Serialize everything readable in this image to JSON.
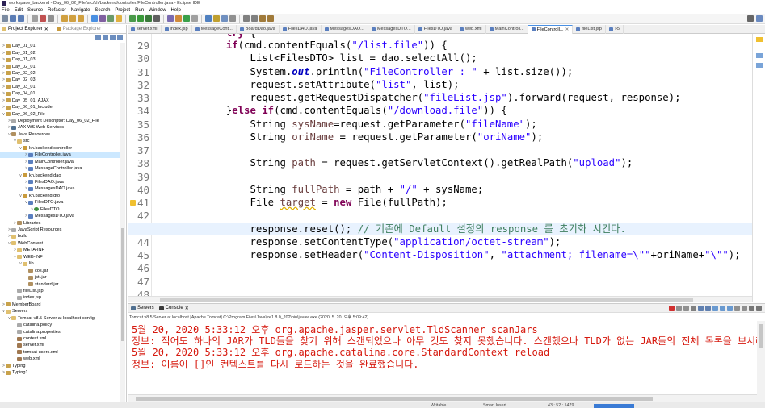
{
  "window": {
    "title": "workspace_backend - Day_06_02_File/src/kh/backend/controller/FileController.java - Eclipse IDE"
  },
  "menu": [
    "File",
    "Edit",
    "Source",
    "Refactor",
    "Navigate",
    "Search",
    "Project",
    "Run",
    "Window",
    "Help"
  ],
  "left_panel": {
    "tabs": [
      {
        "label": "Project Explorer",
        "close": "✕"
      },
      {
        "label": "Package Explorer"
      }
    ],
    "tree": [
      {
        "indent": 0,
        "arrow": ">",
        "icon": "proj",
        "label": "Day_01_01"
      },
      {
        "indent": 0,
        "arrow": ">",
        "icon": "proj",
        "label": "Day_01_02"
      },
      {
        "indent": 0,
        "arrow": ">",
        "icon": "proj",
        "label": "Day_01_03"
      },
      {
        "indent": 0,
        "arrow": ">",
        "icon": "proj",
        "label": "Day_02_01"
      },
      {
        "indent": 0,
        "arrow": ">",
        "icon": "proj",
        "label": "Day_02_02"
      },
      {
        "indent": 0,
        "arrow": ">",
        "icon": "proj",
        "label": "Day_02_03"
      },
      {
        "indent": 0,
        "arrow": ">",
        "icon": "proj",
        "label": "Day_03_01"
      },
      {
        "indent": 0,
        "arrow": ">",
        "icon": "proj",
        "label": "Day_04_01"
      },
      {
        "indent": 0,
        "arrow": ">",
        "icon": "proj",
        "label": "Day_05_01_AJAX"
      },
      {
        "indent": 0,
        "arrow": ">",
        "icon": "proj",
        "label": "Day_06_01_Include"
      },
      {
        "indent": 0,
        "arrow": "v",
        "icon": "proj",
        "label": "Day_06_02_File"
      },
      {
        "indent": 1,
        "arrow": ">",
        "icon": "file",
        "label": "Deployment Descriptor: Day_06_02_File"
      },
      {
        "indent": 1,
        "arrow": ">",
        "icon": "server",
        "label": "JAX-WS Web Services"
      },
      {
        "indent": 1,
        "arrow": "v",
        "icon": "jar",
        "label": "Java Resources"
      },
      {
        "indent": 2,
        "arrow": "v",
        "icon": "folder",
        "label": "src"
      },
      {
        "indent": 3,
        "arrow": "v",
        "icon": "pkg",
        "label": "kh.backend.controller"
      },
      {
        "indent": 4,
        "arrow": ">",
        "icon": "java",
        "label": "FileController.java",
        "selected": true
      },
      {
        "indent": 4,
        "arrow": ">",
        "icon": "java",
        "label": "MainController.java"
      },
      {
        "indent": 4,
        "arrow": ">",
        "icon": "java",
        "label": "MessageController.java"
      },
      {
        "indent": 3,
        "arrow": "v",
        "icon": "pkg",
        "label": "kh.backend.dao"
      },
      {
        "indent": 4,
        "arrow": ">",
        "icon": "java",
        "label": "FilesDAO.java"
      },
      {
        "indent": 4,
        "arrow": ">",
        "icon": "java",
        "label": "MessagesDAO.java"
      },
      {
        "indent": 3,
        "arrow": "v",
        "icon": "pkg",
        "label": "kh.backend.dto"
      },
      {
        "indent": 4,
        "arrow": "v",
        "icon": "java",
        "label": "FilesDTO.java"
      },
      {
        "indent": 5,
        "arrow": ">",
        "icon": "cls",
        "label": "FilesDTO"
      },
      {
        "indent": 4,
        "arrow": ">",
        "icon": "java",
        "label": "MessagesDTO.java"
      },
      {
        "indent": 2,
        "arrow": ">",
        "icon": "jar",
        "label": "Libraries"
      },
      {
        "indent": 1,
        "arrow": ">",
        "icon": "file",
        "label": "JavaScript Resources"
      },
      {
        "indent": 1,
        "arrow": ">",
        "icon": "folder",
        "label": "build"
      },
      {
        "indent": 1,
        "arrow": "v",
        "icon": "folder",
        "label": "WebContent"
      },
      {
        "indent": 2,
        "arrow": ">",
        "icon": "folder",
        "label": "META-INF"
      },
      {
        "indent": 2,
        "arrow": "v",
        "icon": "folder",
        "label": "WEB-INF"
      },
      {
        "indent": 3,
        "arrow": "v",
        "icon": "folder",
        "label": "lib"
      },
      {
        "indent": 4,
        "arrow": "",
        "icon": "jar",
        "label": "cos.jar"
      },
      {
        "indent": 4,
        "arrow": "",
        "icon": "jar",
        "label": "jstl.jar"
      },
      {
        "indent": 4,
        "arrow": "",
        "icon": "jar",
        "label": "standard.jar"
      },
      {
        "indent": 2,
        "arrow": "",
        "icon": "file",
        "label": "fileList.jsp"
      },
      {
        "indent": 2,
        "arrow": "",
        "icon": "file",
        "label": "index.jsp"
      },
      {
        "indent": 0,
        "arrow": ">",
        "icon": "proj",
        "label": "MemberBoard"
      },
      {
        "indent": 0,
        "arrow": "v",
        "icon": "folder",
        "label": "Servers"
      },
      {
        "indent": 1,
        "arrow": "v",
        "icon": "folder",
        "label": "Tomcat v8.5 Server at localhost-config"
      },
      {
        "indent": 2,
        "arrow": "",
        "icon": "file",
        "label": "catalina.policy"
      },
      {
        "indent": 2,
        "arrow": "",
        "icon": "file",
        "label": "catalina.properties"
      },
      {
        "indent": 2,
        "arrow": "",
        "icon": "xml",
        "label": "context.xml"
      },
      {
        "indent": 2,
        "arrow": "",
        "icon": "xml",
        "label": "server.xml"
      },
      {
        "indent": 2,
        "arrow": "",
        "icon": "xml",
        "label": "tomcat-users.xml"
      },
      {
        "indent": 2,
        "arrow": "",
        "icon": "xml",
        "label": "web.xml"
      },
      {
        "indent": 0,
        "arrow": ">",
        "icon": "proj",
        "label": "Typing"
      },
      {
        "indent": 0,
        "arrow": ">",
        "icon": "proj",
        "label": "Typing1"
      }
    ]
  },
  "editor_tabs": [
    {
      "label": "server.xml"
    },
    {
      "label": "index.jsp"
    },
    {
      "label": "MessageCont..."
    },
    {
      "label": "BoardDao.java"
    },
    {
      "label": "FilesDAO.java"
    },
    {
      "label": "MessagesDAO..."
    },
    {
      "label": "MessagesDTO..."
    },
    {
      "label": "FilesDTO.java"
    },
    {
      "label": "web.xml"
    },
    {
      "label": "MainControll..."
    },
    {
      "label": "FileControll...",
      "active": true,
      "close": "✕"
    },
    {
      "label": "fileList.jsp"
    },
    {
      "label": "»5"
    }
  ],
  "code": {
    "partial_top": "try {",
    "lines": [
      {
        "n": "29",
        "html": "            <span class=\"kw\">if</span>(cmd.contentEquals(<span class=\"st\">\"/list.file\"</span>)) {"
      },
      {
        "n": "30",
        "html": "                List&lt;FilesDTO&gt; list = dao.selectAll();"
      },
      {
        "n": "31",
        "html": "                System.<span class=\"fd\">out</span>.println(<span class=\"st\">\"FileController : \"</span> + list.size());"
      },
      {
        "n": "32",
        "html": "                request.setAttribute(<span class=\"st\">\"list\"</span>, list);"
      },
      {
        "n": "33",
        "html": "                request.getRequestDispatcher(<span class=\"st\">\"fileList.jsp\"</span>).forward(request, response);"
      },
      {
        "n": "34",
        "html": "            }<span class=\"kw\">else if</span>(cmd.contentEquals(<span class=\"st\">\"/download.file\"</span>)) {"
      },
      {
        "n": "35",
        "html": "                String <span class=\"vr\">sysName</span>=request.getParameter(<span class=\"st\">\"fileName\"</span>);"
      },
      {
        "n": "36",
        "html": "                String <span class=\"vr\">oriName</span> = request.getParameter(<span class=\"st\">\"oriName\"</span>);"
      },
      {
        "n": "37",
        "html": ""
      },
      {
        "n": "38",
        "html": "                String <span class=\"vr\">path</span> = request.getServletContext().getRealPath(<span class=\"st\">\"upload\"</span>);"
      },
      {
        "n": "39",
        "html": ""
      },
      {
        "n": "40",
        "html": "                String <span class=\"vr\">fullPath</span> = path + <span class=\"st\">\"/\"</span> + sysName;"
      },
      {
        "n": "41",
        "html": "                File <span class=\"vr\" style=\"text-decoration: underline wavy #e0b000;\">target</span> = <span class=\"kw\">new</span> File(fullPath);",
        "warn": true
      },
      {
        "n": "42",
        "html": ""
      },
      {
        "n": "43",
        "html": "                response.reset(); <span class=\"cm\">// 기존에 Default 설정의 response 를 초기화 시킨다.</span>",
        "highlight": true
      },
      {
        "n": "44",
        "html": "                response.setContentType(<span class=\"st\">\"application/octet-stream\"</span>);"
      },
      {
        "n": "45",
        "html": "                response.setHeader(<span class=\"st\">\"Content-Disposition\"</span>, <span class=\"st\">\"attachment; filename=\\\"\"</span>+oriName+<span class=\"st\">\"\\\"\"</span>);"
      },
      {
        "n": "46",
        "html": ""
      },
      {
        "n": "47",
        "html": ""
      },
      {
        "n": "48",
        "html": ""
      }
    ]
  },
  "console": {
    "tabs": [
      {
        "label": "Servers"
      },
      {
        "label": "Console",
        "close": "✕",
        "active": true
      }
    ],
    "description": "Tomcat v8.5 Server at localhost [Apache Tomcat] C:\\Program Files\\Java\\jre1.8.0_202\\bin\\javaw.exe (2020. 5. 20. 오후 5:09:42)",
    "lines": [
      "5월 20, 2020 5:33:12 오후 org.apache.jasper.servlet.TldScanner scanJars",
      "정보: 적어도 하나의 JAR가 TLD들을 찾기 위해 스캔되었으나 아무 것도 찾지 못했습니다. 스캔했으나 TLD가 없는 JAR들의 전체 목록을 보시려면, 로",
      "5월 20, 2020 5:33:12 오후 org.apache.catalina.core.StandardContext reload",
      "정보: 이름이 []인 컨텍스트를 다시 로드하는 것을 완료했습니다."
    ]
  },
  "status": {
    "writable": "Writable",
    "insert_mode": "Smart Insert",
    "position": "43 : 52 : 1479"
  },
  "colors": {
    "keyword": "#7f0055",
    "string": "#2a00ff",
    "comment": "#3f7f5f",
    "console_text": "#d6190e",
    "current_line": "#e8f2fe"
  }
}
